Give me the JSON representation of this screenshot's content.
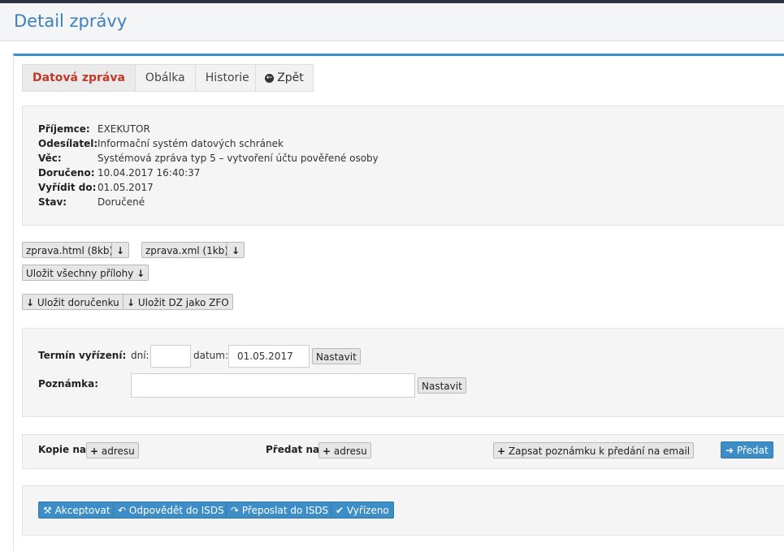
{
  "page": {
    "title": "Detail zprávy"
  },
  "tabs": [
    {
      "label": "Datová zpráva",
      "active": true
    },
    {
      "label": "Obálka",
      "active": false
    },
    {
      "label": "Historie",
      "active": false
    }
  ],
  "back_button": {
    "label": "Zpět",
    "icon": "arrow-circle-left-icon"
  },
  "message": {
    "rows": [
      {
        "label": "Příjemce:",
        "value": "EXEKUTOR"
      },
      {
        "label": "Odesílatel:",
        "value": "Informační systém datových schránek"
      },
      {
        "label": "Věc:",
        "value": "Systémová zpráva typ 5 – vytvoření účtu pověřené osoby"
      },
      {
        "label": "Doručeno:",
        "value": "10.04.2017 16:40:37"
      },
      {
        "label": "Vyřídit do:",
        "value": "01.05.2017"
      },
      {
        "label": "Stav:",
        "value": "Doručené"
      }
    ]
  },
  "attachments": {
    "files": [
      "zprava.html (8kb)",
      "zprava.xml (1kb)"
    ],
    "download_icon": "↓",
    "save_all": "Uložit všechny přílohy",
    "save_receipt": "Uložit doručenku",
    "save_zfo": "Uložit DZ jako ZFO"
  },
  "deadline_form": {
    "termin_label": "Termín vyřízení:",
    "days_label": "dní:",
    "days_value": "",
    "date_label": "datum:",
    "date_value": "01.05.2017",
    "set_label": "Nastavit",
    "note_label": "Poznámka:",
    "note_value": "",
    "note_set_label": "Nastavit"
  },
  "forwarding": {
    "copy_label": "Kopie na:",
    "copy_add": "adresu",
    "forward_label": "Předat na:",
    "forward_add": "adresu",
    "note_email": "Zapsat poznámku k předání na email",
    "forward_button": "Předat"
  },
  "actions": {
    "accept": "Akceptovat",
    "reply": "Odpovědět do ISDS",
    "resend": "Přeposlat do ISDS",
    "done": "Vyřízeno"
  },
  "colors": {
    "accent": "#3d8dc6",
    "title": "#3b7fbf",
    "active_tab": "#c0392b"
  }
}
